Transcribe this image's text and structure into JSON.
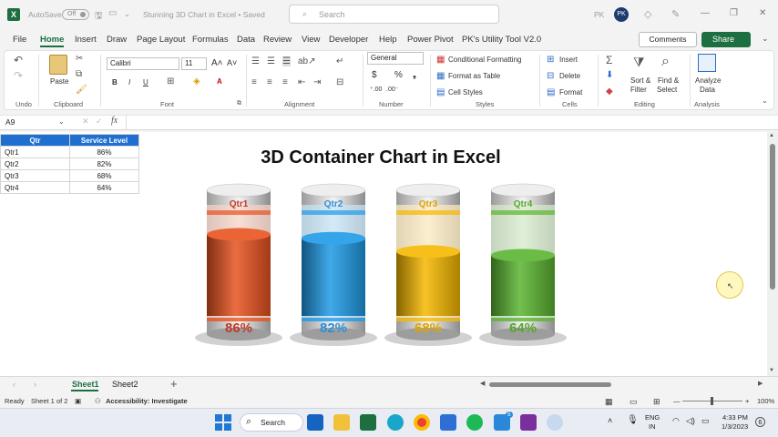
{
  "titlebar": {
    "autosave_label": "AutoSave",
    "autosave_state": "Off",
    "doc_title": "Stunning 3D Chart in Excel • Saved",
    "search_placeholder": "Search",
    "user_initials": "PK"
  },
  "menu": [
    "File",
    "Home",
    "Insert",
    "Draw",
    "Page Layout",
    "Formulas",
    "Data",
    "Review",
    "View",
    "Developer",
    "Help",
    "Power Pivot",
    "PK's Utility Tool V2.0"
  ],
  "menu_active": "Home",
  "actions": {
    "comments": "Comments",
    "share": "Share"
  },
  "ribbon": {
    "font_name": "Calibri",
    "font_size": "11",
    "number_format": "General",
    "groups": [
      "Undo",
      "Clipboard",
      "Font",
      "Alignment",
      "Number",
      "Styles",
      "Cells",
      "Editing",
      "Analysis"
    ],
    "paste": "Paste",
    "styles_items": [
      "Conditional Formatting",
      "Format as Table",
      "Cell Styles"
    ],
    "cells_items": [
      "Insert",
      "Delete",
      "Format"
    ],
    "sort_filter": [
      "Sort &",
      "Filter"
    ],
    "find_select": [
      "Find &",
      "Select"
    ],
    "analyze": [
      "Analyze",
      "Data"
    ]
  },
  "formula": {
    "namebox": "A9",
    "fx": "fx"
  },
  "table": {
    "headers": [
      "Qtr",
      "Service Level"
    ],
    "rows": [
      [
        "Qtr1",
        "86%"
      ],
      [
        "Qtr2",
        "82%"
      ],
      [
        "Qtr3",
        "68%"
      ],
      [
        "Qtr4",
        "64%"
      ]
    ]
  },
  "chart_data": {
    "type": "bar",
    "title": "3D Container Chart in Excel",
    "categories": [
      "Qtr1",
      "Qtr2",
      "Qtr3",
      "Qtr4"
    ],
    "values": [
      86,
      82,
      68,
      64
    ],
    "value_labels": [
      "86%",
      "82%",
      "68%",
      "64%"
    ],
    "colors": [
      "#e8531f",
      "#1f9be6",
      "#f5b800",
      "#5bb531"
    ],
    "label_colors": [
      "#c0392b",
      "#2f8fd8",
      "#e0a400",
      "#54a82c"
    ],
    "ylim": [
      0,
      100
    ]
  },
  "sheets": [
    "Sheet1",
    "Sheet2"
  ],
  "status": {
    "ready": "Ready",
    "sheet_info": "Sheet 1 of 2",
    "accessibility": "Accessibility: Investigate",
    "zoom": "100%"
  },
  "taskbar": {
    "search": "Search",
    "lang_top": "ENG",
    "lang_bottom": "IN",
    "time": "4:33 PM",
    "date": "1/3/2023",
    "notif_count": "6",
    "badge": "5"
  }
}
